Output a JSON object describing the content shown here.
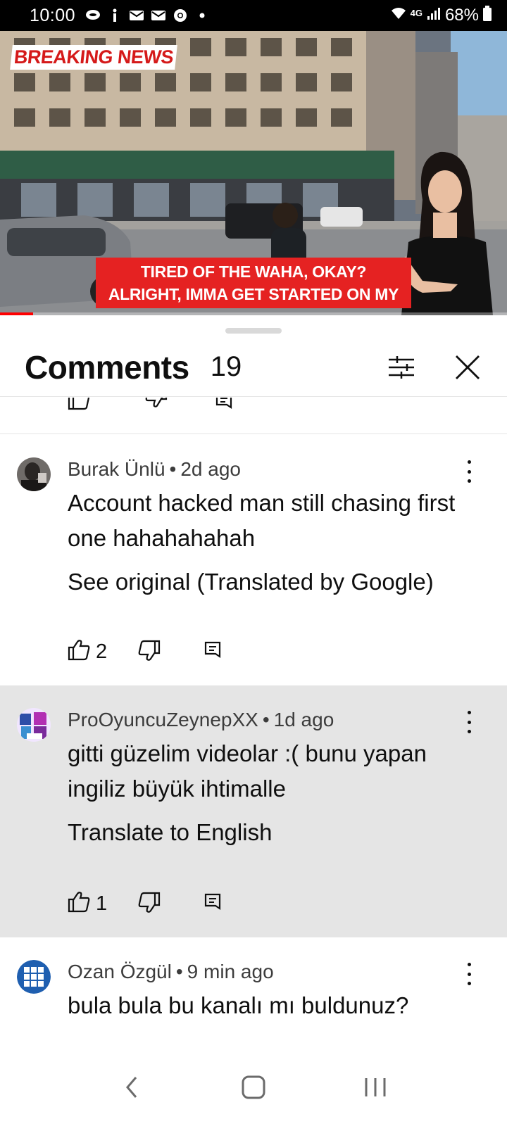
{
  "status_bar": {
    "time": "10:00",
    "network": "4G",
    "battery": "68%",
    "icons": [
      "chat-icon",
      "info-icon",
      "mail-icon",
      "mail-icon",
      "chrome-icon",
      "dot-icon",
      "wifi-icon",
      "signal-icon",
      "battery-icon"
    ]
  },
  "video": {
    "badge": "BREAKING NEWS",
    "caption_line1": "TIRED OF THE WAHA, OKAY?",
    "caption_line2": "ALRIGHT, IMMA GET STARTED ON MY",
    "progress_fraction": 0.065
  },
  "comments_panel": {
    "title": "Comments",
    "count": "19",
    "icons": {
      "filter": "filter-sliders-icon",
      "close": "close-icon"
    }
  },
  "comments": [
    {
      "author": "Burak Ünlü",
      "age": "2d ago",
      "text": "Account hacked man still chasing first one hahahahahah",
      "translate": "See original (Translated by Google)",
      "likes": "2"
    },
    {
      "author": "ProOyuncuZeynepXX",
      "age": "1d ago",
      "text": "gitti güzelim videolar :( bunu yapan ingiliz büyük ihtimalle",
      "translate": "Translate to English",
      "likes": "1"
    },
    {
      "author": "Ozan Özgül",
      "age": "9 min ago",
      "text": "bula bula bu kanalı mı buldunuz?"
    }
  ],
  "meta_separator": "•",
  "colors": {
    "highlight_bg": "#e5e5e5",
    "caption_red": "#e52222",
    "progress_red": "#ff0000"
  }
}
